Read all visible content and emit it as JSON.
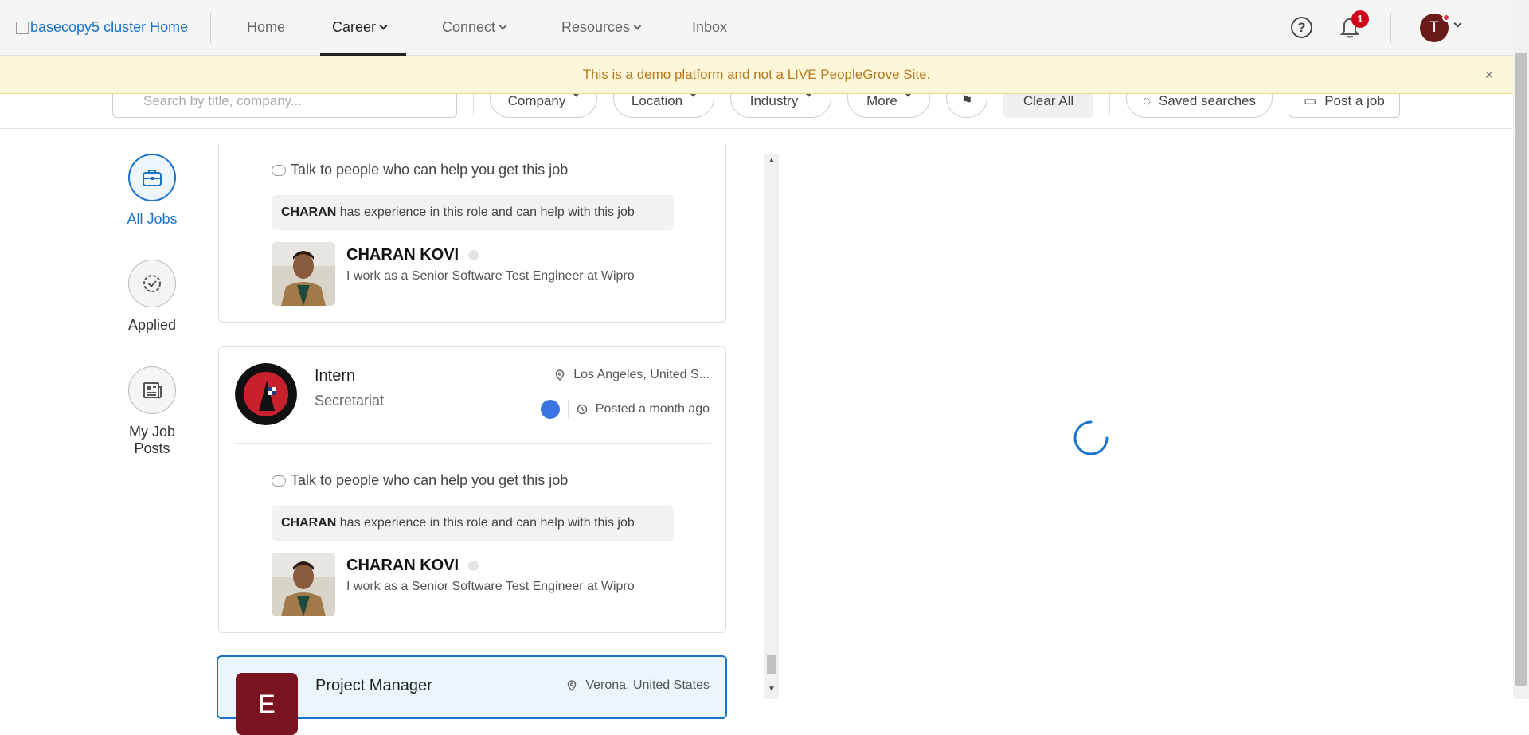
{
  "topnav": {
    "logo_alt": "basecopy5 cluster Home",
    "items": [
      {
        "label": "Home"
      },
      {
        "label": "Career"
      },
      {
        "label": "Connect"
      },
      {
        "label": "Resources"
      },
      {
        "label": "Inbox"
      }
    ],
    "active": "Career",
    "notification_count": "1",
    "avatar_initial": "T"
  },
  "banner": {
    "text": "This is a demo platform and not a LIVE PeopleGrove Site.",
    "close": "×"
  },
  "filters": {
    "search_placeholder": "Search by title, company...",
    "buttons": [
      {
        "label": "Company"
      },
      {
        "label": "Location"
      },
      {
        "label": "Industry"
      },
      {
        "label": "More"
      }
    ],
    "clear_all": "Clear All",
    "saved_searches": "Saved searches",
    "post_job": "Post a job"
  },
  "sidebar": {
    "items": [
      {
        "label": "All Jobs",
        "icon": "briefcase-icon",
        "active": true
      },
      {
        "label": "Applied",
        "icon": "check-badge-icon",
        "active": false
      },
      {
        "label": "My Job Posts",
        "icon": "news-icon",
        "active": false
      }
    ]
  },
  "cards": [
    {
      "talk_heading": "Talk to people who can help you get this job",
      "experience_name": "CHARAN",
      "experience_text": "has experience in this role and can help with this job",
      "person_name": "CHARAN KOVI",
      "person_desc": "I work as a Senior Software Test Engineer at Wipro"
    },
    {
      "job_title": "Intern",
      "company": "Secretariat",
      "location": "Los Angeles, United S...",
      "posted": "Posted a month ago",
      "talk_heading": "Talk to people who can help you get this job",
      "experience_name": "CHARAN",
      "experience_text": "has experience in this role and can help with this job",
      "person_name": "CHARAN KOVI",
      "person_desc": "I work as a Senior Software Test Engineer at Wipro"
    },
    {
      "job_title": "Project Manager",
      "logo_initial": "E",
      "location": "Verona, United States"
    }
  ],
  "colors": {
    "accent": "#1a73c8",
    "banner_text": "#b7791f",
    "banner_bg": "#fef6d8",
    "badge": "#d0021b",
    "avatar": "#6b1a1a",
    "selected_card_bg": "#eaf6fb"
  }
}
